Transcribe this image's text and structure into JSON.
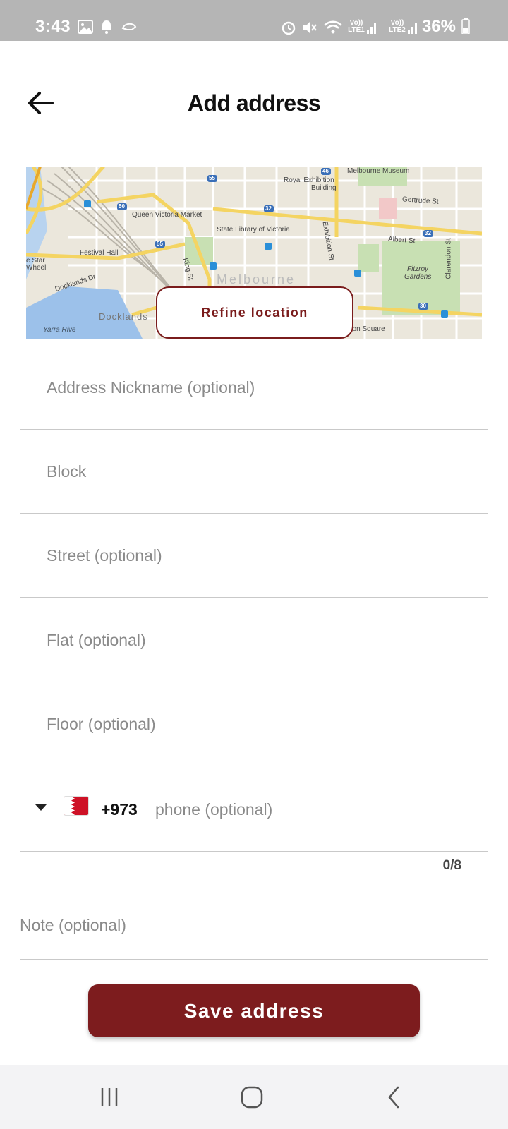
{
  "status_bar": {
    "time": "3:43",
    "battery": "36%",
    "net1": "Vo)) LTE1",
    "net2": "Vo)) LTE2"
  },
  "header": {
    "title": "Add address",
    "back_icon": "arrow-left-icon"
  },
  "map": {
    "labels": {
      "melbourne_museum": "Melbourne Museum",
      "royal_exhibition": "Royal Exhibition",
      "building": "Building",
      "gertrude": "Gertrude St",
      "qvm": "Queen Victoria Market",
      "state_library": "State Library of Victoria",
      "albert": "Albert St",
      "exhibition": "Exhibition St",
      "clarendon": "Clarendon St",
      "fitzroy": "Fitzroy",
      "gardens": "Gardens",
      "festival_hall": "Festival Hall",
      "star_wheel_1": "e Star",
      "star_wheel_2": "Wheel",
      "docklands_dr": "Docklands Dr",
      "docklands": "Docklands",
      "yarra": "Yarra Rive",
      "station_square": "ation Square",
      "king": "King St",
      "melbourne": "Melbourne",
      "route_46": "46",
      "route_55a": "55",
      "route_50": "50",
      "route_32a": "32",
      "route_55b": "55",
      "route_32b": "32",
      "route_30": "30"
    },
    "refine_label": "Refine location"
  },
  "form": {
    "nickname_placeholder": "Address Nickname (optional)",
    "block_placeholder": "Block",
    "street_placeholder": "Street (optional)",
    "flat_placeholder": "Flat (optional)",
    "floor_placeholder": "Floor (optional)",
    "phone": {
      "dial_code": "+973",
      "placeholder": "phone (optional)",
      "counter": "0/8",
      "flag_icon": "bahrain-flag-icon"
    },
    "note_placeholder": "Note (optional)"
  },
  "actions": {
    "save_label": "Save address"
  },
  "colors": {
    "brand": "#7d1c1e",
    "status_bar": "#b5b5b5",
    "nav_bar": "#f3f3f5"
  }
}
